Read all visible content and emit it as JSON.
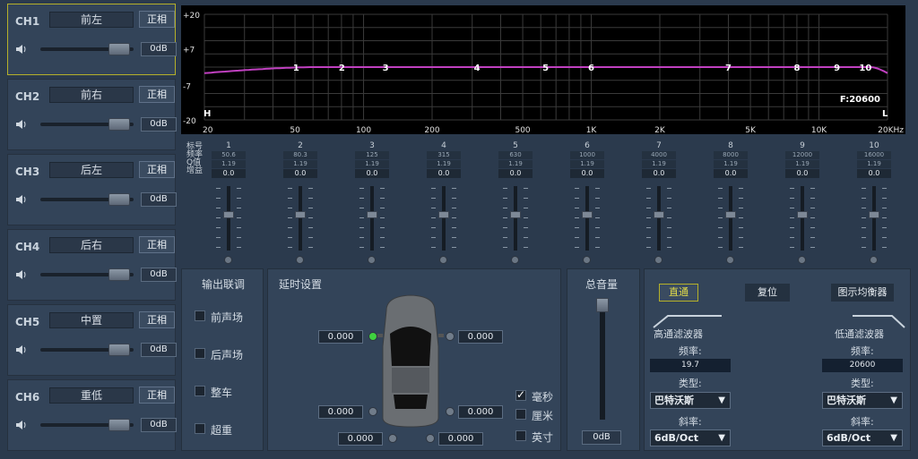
{
  "channels": [
    {
      "id": "CH1",
      "name": "前左",
      "phase": "正相",
      "db": "0dB",
      "selected": true
    },
    {
      "id": "CH2",
      "name": "前右",
      "phase": "正相",
      "db": "0dB",
      "selected": false
    },
    {
      "id": "CH3",
      "name": "后左",
      "phase": "正相",
      "db": "0dB",
      "selected": false
    },
    {
      "id": "CH4",
      "name": "后右",
      "phase": "正相",
      "db": "0dB",
      "selected": false
    },
    {
      "id": "CH5",
      "name": "中置",
      "phase": "正相",
      "db": "0dB",
      "selected": false
    },
    {
      "id": "CH6",
      "name": "重低",
      "phase": "正相",
      "db": "0dB",
      "selected": false
    }
  ],
  "graph": {
    "y_labels": [
      "+20",
      "+7",
      "-7",
      "-20"
    ],
    "x_labels": [
      "20",
      "50",
      "100",
      "200",
      "500",
      "1K",
      "2K",
      "5K",
      "10K",
      "20KHz"
    ],
    "h_marker": "H",
    "l_marker": "L",
    "freq_readout": "F:20600",
    "band_markers": [
      "1",
      "2",
      "3",
      "4",
      "5",
      "6",
      "7",
      "8",
      "9",
      "10"
    ],
    "curve_color": "#c040c0"
  },
  "band_row_labels": [
    "标号",
    "频率",
    "Q值",
    "增益"
  ],
  "bands": [
    {
      "num": "1",
      "freq": "50.6",
      "q": "1.19",
      "gain": "0.0"
    },
    {
      "num": "2",
      "freq": "80.3",
      "q": "1.19",
      "gain": "0.0"
    },
    {
      "num": "3",
      "freq": "125",
      "q": "1.19",
      "gain": "0.0"
    },
    {
      "num": "4",
      "freq": "315",
      "q": "1.19",
      "gain": "0.0"
    },
    {
      "num": "5",
      "freq": "630",
      "q": "1.19",
      "gain": "0.0"
    },
    {
      "num": "6",
      "freq": "1000",
      "q": "1.19",
      "gain": "0.0"
    },
    {
      "num": "7",
      "freq": "4000",
      "q": "1.19",
      "gain": "0.0"
    },
    {
      "num": "8",
      "freq": "8000",
      "q": "1.19",
      "gain": "0.0"
    },
    {
      "num": "9",
      "freq": "12000",
      "q": "1.19",
      "gain": "0.0"
    },
    {
      "num": "10",
      "freq": "16000",
      "q": "1.19",
      "gain": "0.0"
    }
  ],
  "link": {
    "title": "输出联调",
    "options": [
      "前声场",
      "后声场",
      "整车",
      "超重"
    ]
  },
  "delay": {
    "title": "延时设置",
    "values": [
      "0.000",
      "0.000",
      "0.000",
      "0.000",
      "0.000",
      "0.000"
    ],
    "units": [
      {
        "label": "毫秒",
        "checked": true
      },
      {
        "label": "厘米",
        "checked": false
      },
      {
        "label": "英寸",
        "checked": false
      }
    ]
  },
  "master": {
    "title": "总音量",
    "db": "0dB"
  },
  "buttons": {
    "bypass": "直通",
    "reset": "复位",
    "graphic_eq": "图示均衡器"
  },
  "hpf": {
    "title": "高通滤波器",
    "freq_label": "频率:",
    "freq": "19.7",
    "type_label": "类型:",
    "type": "巴特沃斯",
    "slope_label": "斜率:",
    "slope": "6dB/Oct"
  },
  "lpf": {
    "title": "低通滤波器",
    "freq_label": "频率:",
    "freq": "20600",
    "type_label": "类型:",
    "type": "巴特沃斯",
    "slope_label": "斜率:",
    "slope": "6dB/Oct"
  }
}
